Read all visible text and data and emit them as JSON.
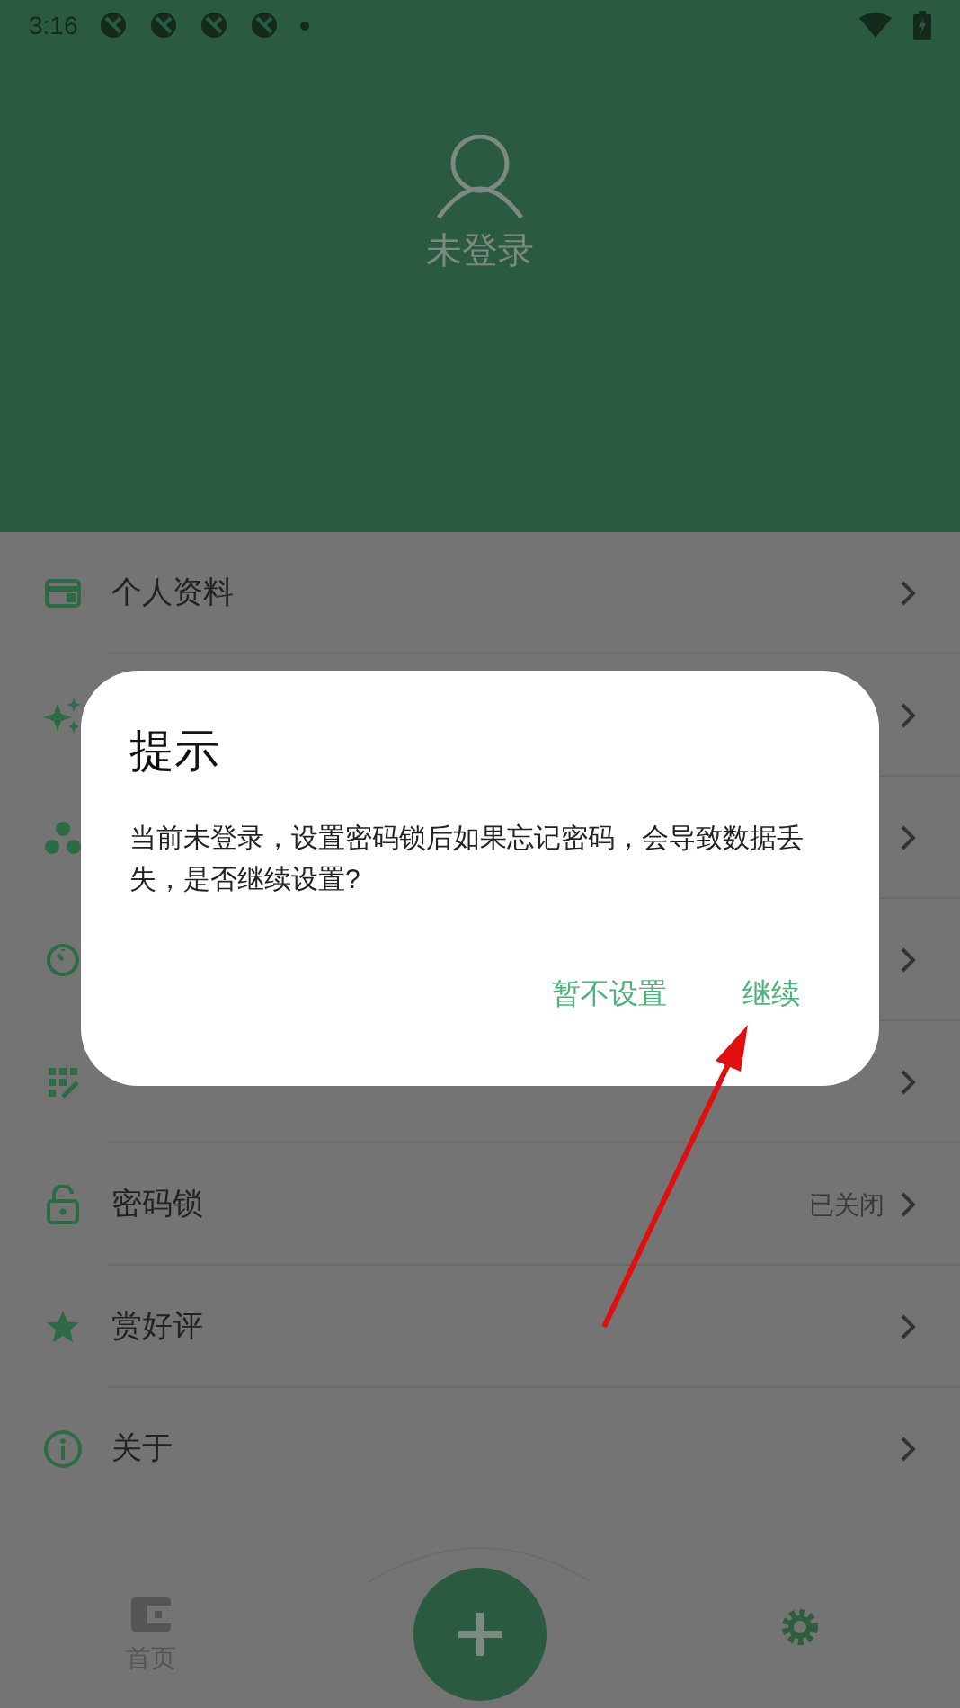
{
  "status_bar": {
    "time": "3:16"
  },
  "profile": {
    "label": "未登录"
  },
  "menu": [
    {
      "kind": "row",
      "label": "个人资料"
    },
    {
      "kind": "covered"
    },
    {
      "kind": "covered"
    },
    {
      "kind": "covered"
    },
    {
      "kind": "covered"
    },
    {
      "kind": "row",
      "label": "密码锁",
      "value": "已关闭"
    },
    {
      "kind": "row",
      "label": "赏好评"
    },
    {
      "kind": "row",
      "label": "关于"
    }
  ],
  "bottom_nav": [
    {
      "kind": "labeled",
      "label": "首页"
    },
    {
      "kind": "icon"
    }
  ],
  "dialog": {
    "title": "提示",
    "message": "当前未登录，设置密码锁后如果忘记密码，会导致数据丢失，是否继续设置?",
    "buttons": [
      "暂不设置",
      "继续"
    ]
  }
}
